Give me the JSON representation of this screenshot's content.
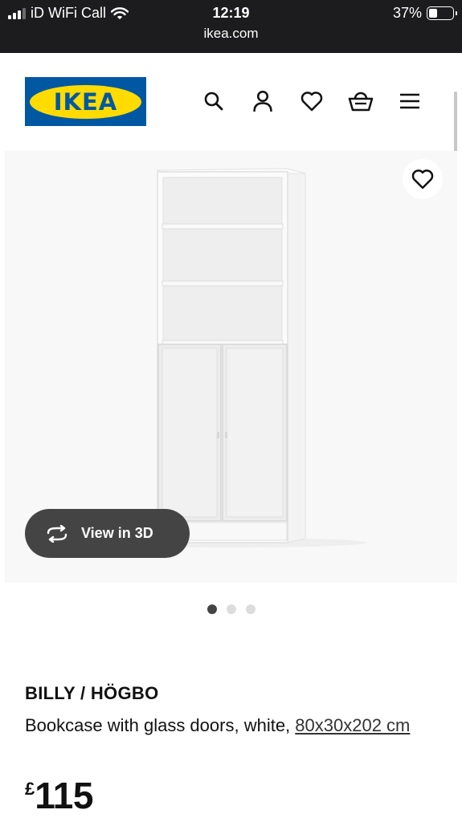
{
  "status_bar": {
    "carrier": "iD WiFi Call",
    "time": "12:19",
    "url": "ikea.com",
    "battery_percent": "37%",
    "battery_level": 0.37
  },
  "header": {
    "logo_text": "IKEA",
    "brand_colors": {
      "blue": "#0058a3",
      "yellow": "#ffdb00"
    },
    "icons": [
      "search-icon",
      "account-icon",
      "heart-icon",
      "basket-icon",
      "menu-icon"
    ]
  },
  "gallery": {
    "view_3d_label": "View in 3D",
    "slide_count": 3,
    "active_slide": 1
  },
  "product": {
    "name": "BILLY / HÖGBO",
    "description": "Bookcase with glass doors, white,",
    "dimensions": "80x30x202 cm",
    "currency": "£",
    "price": "115"
  }
}
